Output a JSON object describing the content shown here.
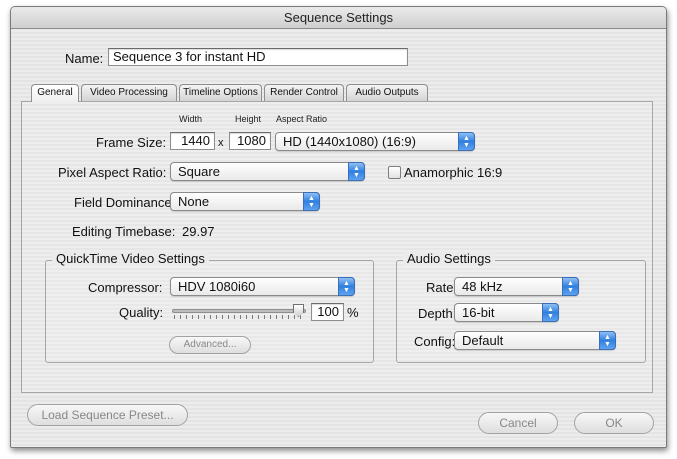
{
  "window": {
    "title": "Sequence Settings"
  },
  "name": {
    "label": "Name:",
    "value": "Sequence 3 for instant HD"
  },
  "tabs": [
    {
      "label": "General",
      "active": true
    },
    {
      "label": "Video Processing",
      "active": false
    },
    {
      "label": "Timeline Options",
      "active": false
    },
    {
      "label": "Render Control",
      "active": false
    },
    {
      "label": "Audio Outputs",
      "active": false
    }
  ],
  "general": {
    "frame_size": {
      "label": "Frame Size:",
      "width_caption": "Width",
      "height_caption": "Height",
      "aspect_caption": "Aspect Ratio",
      "width": "1440",
      "times": "x",
      "height": "1080",
      "aspect_ratio": "HD (1440x1080) (16:9)"
    },
    "pixel_aspect": {
      "label": "Pixel Aspect Ratio:",
      "value": "Square"
    },
    "anamorphic": {
      "label": "Anamorphic 16:9",
      "checked": false
    },
    "field_dominance": {
      "label": "Field Dominance:",
      "value": "None"
    },
    "editing_timebase": {
      "label": "Editing Timebase:",
      "value": "29.97"
    }
  },
  "quicktime": {
    "title": "QuickTime Video Settings",
    "compressor_label": "Compressor:",
    "compressor_value": "HDV 1080i60",
    "quality_label": "Quality:",
    "quality_value": "100",
    "quality_fraction": 1.0,
    "percent": "%",
    "advanced_label": "Advanced..."
  },
  "audio": {
    "title": "Audio Settings",
    "rate_label": "Rate:",
    "rate_value": "48 kHz",
    "depth_label": "Depth:",
    "depth_value": "16-bit",
    "config_label": "Config:",
    "config_value": "Default"
  },
  "footer": {
    "load_preset_label": "Load Sequence Preset...",
    "cancel_label": "Cancel",
    "ok_label": "OK"
  },
  "colors": {
    "popup_accent": "#2f7fe0"
  }
}
